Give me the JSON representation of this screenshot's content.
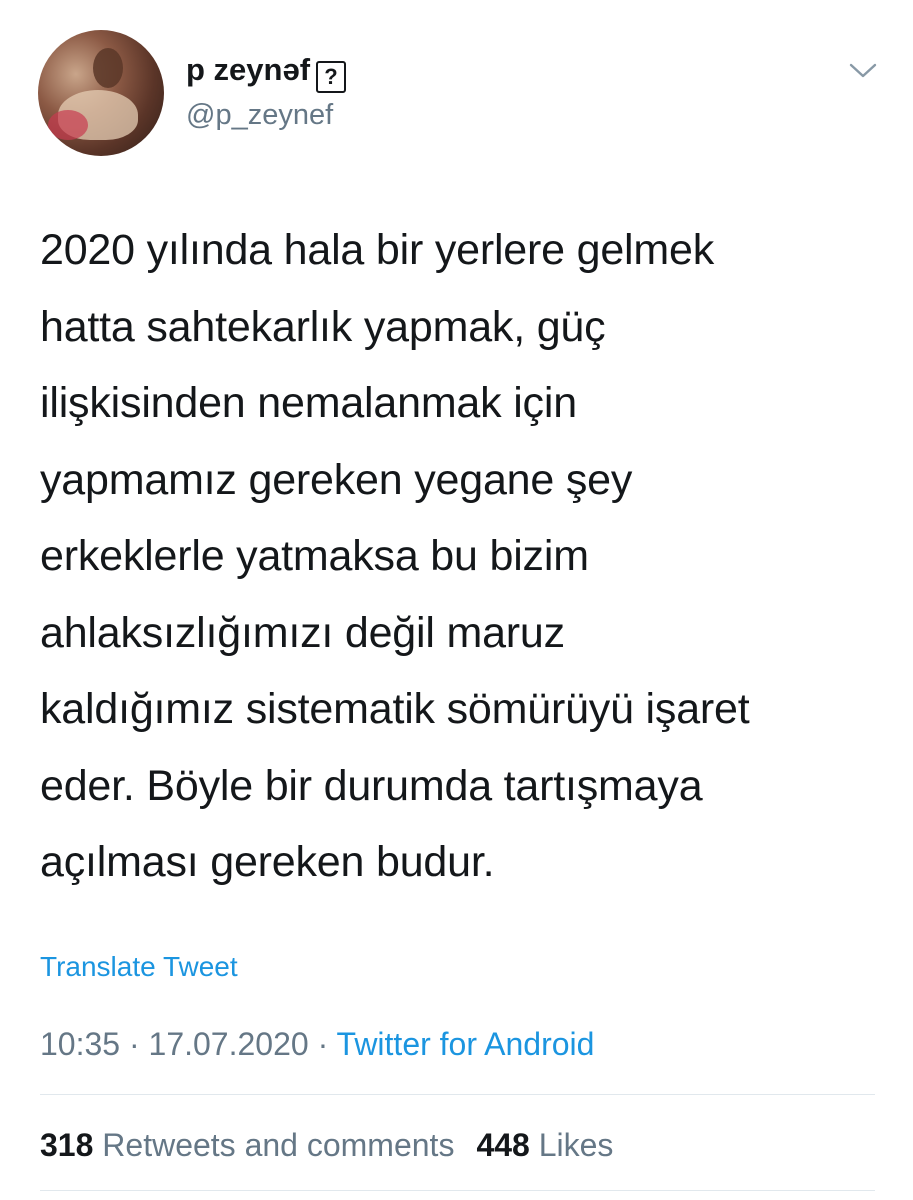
{
  "user": {
    "display_name": "p zeynəf",
    "name_glyph": "?",
    "handle": "@p_zeynef"
  },
  "tweet": {
    "text": "2020 yılında hala bir yerlere gelmek\nhatta sahtekarlık yapmak, güç\nilişkisinden nemalanmak için\nyapmamız gereken yegane şey\nerkeklerle yatmaksa bu bizim\nahlaksızlığımızı değil maruz\nkaldığımız sistematik sömürüyü işaret\neder. Böyle bir durumda tartışmaya\naçılması gereken budur.",
    "translate_label": "Translate Tweet",
    "time": "10:35",
    "separator": "·",
    "date": "17.07.2020",
    "source": "Twitter for Android"
  },
  "stats": {
    "retweets_count": "318",
    "retweets_label": "Retweets and comments",
    "likes_count": "448",
    "likes_label": "Likes"
  },
  "icons": {
    "menu": "chevron-down-icon"
  },
  "colors": {
    "link": "#1b95e0",
    "secondary": "#657786",
    "primary_text": "#14171a",
    "divider": "#e1e8ed"
  }
}
